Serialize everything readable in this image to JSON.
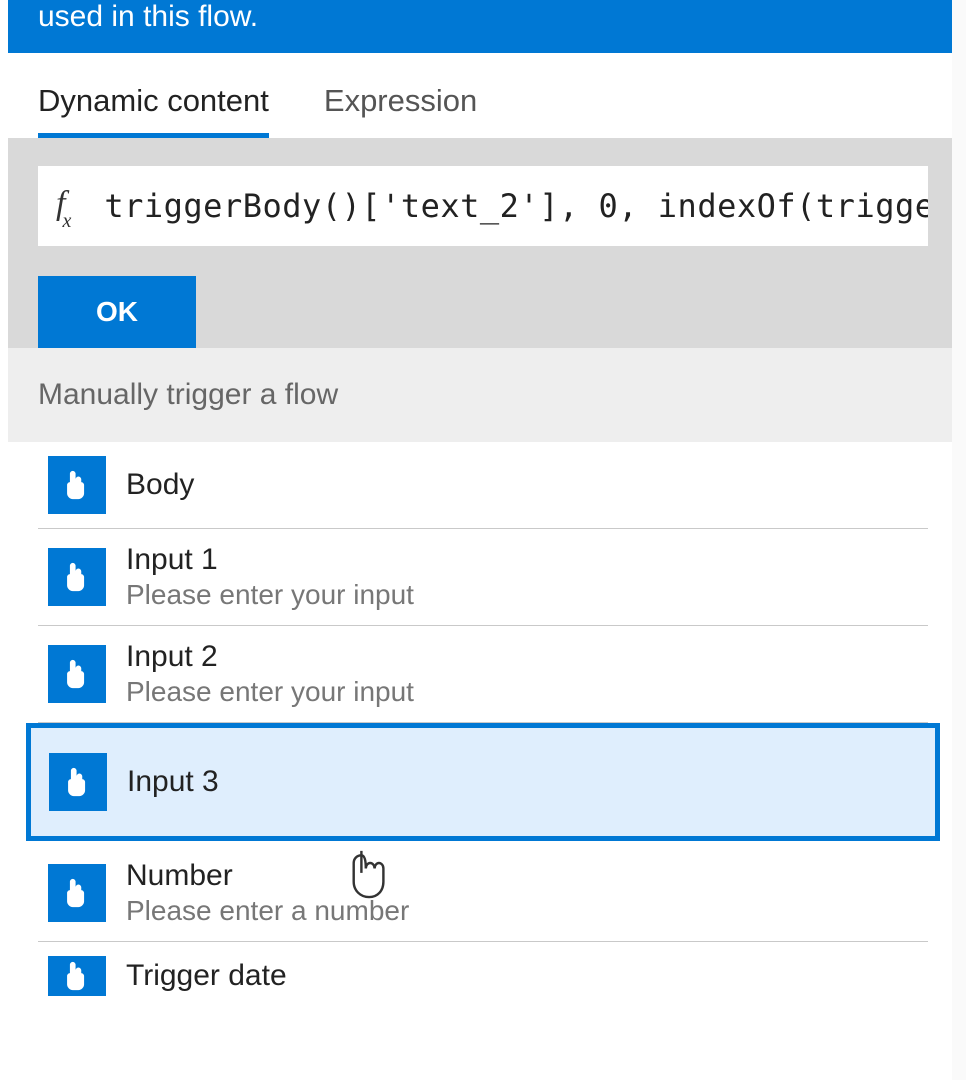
{
  "banner": {
    "text": "used in this flow."
  },
  "tabs": {
    "dynamic": "Dynamic content",
    "expression": "Expression"
  },
  "fx": {
    "label": "f",
    "sub": "x",
    "expression": "triggerBody()['text_2'], 0, indexOf(trigge"
  },
  "buttons": {
    "ok": "OK"
  },
  "section": {
    "title": "Manually trigger a flow"
  },
  "items": [
    {
      "title": "Body",
      "desc": ""
    },
    {
      "title": "Input 1",
      "desc": "Please enter your input"
    },
    {
      "title": "Input 2",
      "desc": "Please enter your input"
    },
    {
      "title": "Input 3",
      "desc": ""
    },
    {
      "title": "Number",
      "desc": "Please enter a number"
    },
    {
      "title": "Trigger date",
      "desc": ""
    }
  ]
}
